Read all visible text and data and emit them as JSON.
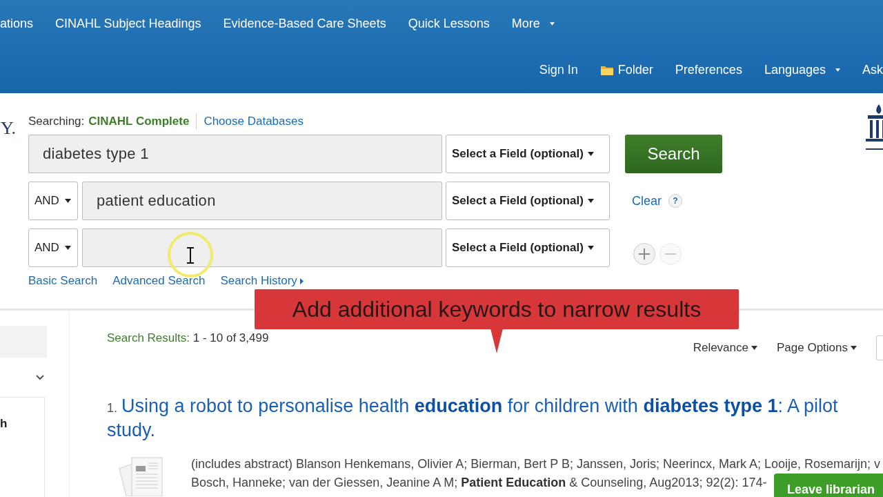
{
  "top_nav": [
    {
      "label": "ations",
      "kind": "link"
    },
    {
      "label": "CINAHL Subject Headings",
      "kind": "link"
    },
    {
      "label": "Evidence-Based Care Sheets",
      "kind": "link"
    },
    {
      "label": "Quick Lessons",
      "kind": "link"
    },
    {
      "label": "More",
      "kind": "menu"
    }
  ],
  "user_nav": [
    {
      "label": "Sign In",
      "kind": "link"
    },
    {
      "label": "Folder",
      "kind": "folder"
    },
    {
      "label": "Preferences",
      "kind": "link"
    },
    {
      "label": "Languages",
      "kind": "menu"
    },
    {
      "label": "Ask",
      "kind": "link"
    }
  ],
  "logo_fragment": "Y.",
  "search": {
    "searching_label": "Searching:",
    "database": "CINAHL Complete",
    "choose_link": "Choose Databases",
    "rows": [
      {
        "value": "diabetes type 1",
        "field": "Select a Field (optional)"
      },
      {
        "operator": "AND",
        "value": "patient education",
        "field": "Select a Field (optional)"
      },
      {
        "operator": "AND",
        "field": "Select a Field (optional)"
      }
    ],
    "search_button": "Search",
    "clear_link": "Clear",
    "help_label": "?",
    "add_row": {
      "disabled": false
    },
    "remove_row": {
      "disabled": true
    },
    "links": [
      "Basic Search",
      "Advanced Search",
      "Search History"
    ]
  },
  "callout": {
    "text": "Add additional keywords to narrow results"
  },
  "sidebar": {
    "fragment": "h"
  },
  "results": {
    "label": "Search Results:",
    "range": "1 - 10 of 3,499",
    "sort": "Relevance",
    "page_options": "Page Options",
    "items": [
      {
        "number": "1.",
        "title": "Using a robot to personalise health **education** for children with **diabetes type 1**: A pilot study.",
        "meta": [
          "(includes abstract) Blanson Henkemans, Olivier A; Bierman, Bert P B; Janssen, Joris; Neerincx, Mark A; Looije, Rosemarijn; v",
          "Bosch, Hanneke; van der Giessen, Jeanine A M; **Patient Education** & Counseling, Aug2013; 92(2): 174-"
        ]
      }
    ]
  },
  "chat_button": "Leave librarian"
}
